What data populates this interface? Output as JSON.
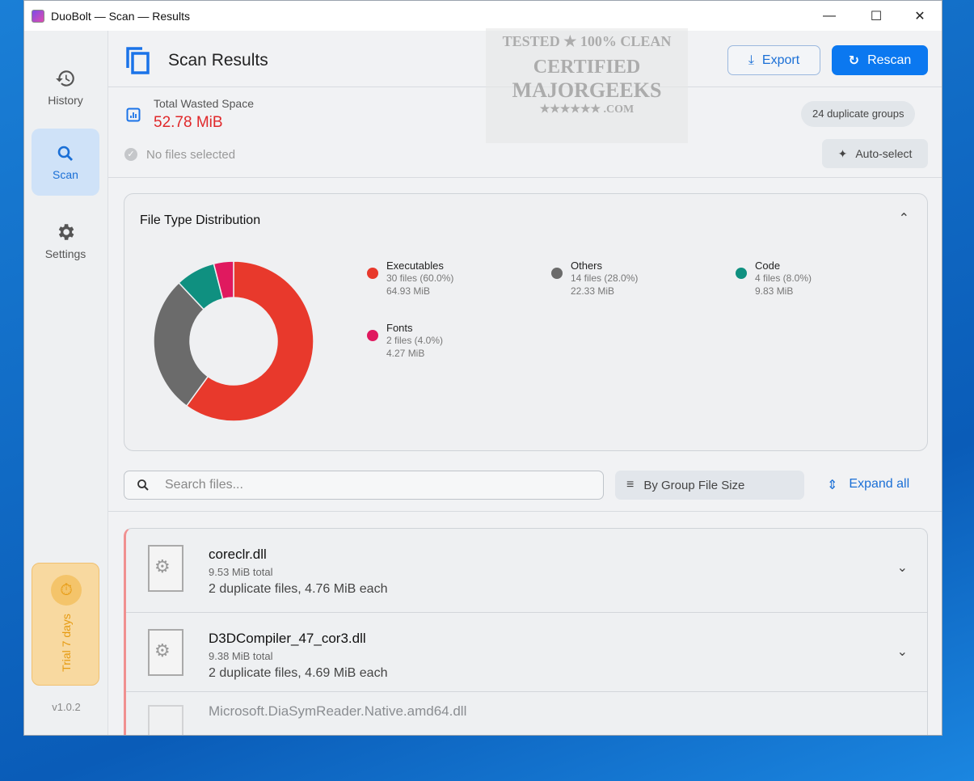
{
  "window": {
    "title": "DuoBolt — Scan — Results",
    "minimize": "—",
    "maximize": "☐",
    "close": "✕"
  },
  "sidebar": {
    "items": [
      {
        "label": "History",
        "icon": "history-icon"
      },
      {
        "label": "Scan",
        "icon": "search-icon"
      },
      {
        "label": "Settings",
        "icon": "gear-icon"
      }
    ],
    "trial": "Trial 7 days",
    "version": "v1.0.2"
  },
  "header": {
    "title": "Scan Results",
    "export": "Export",
    "rescan": "Rescan"
  },
  "stats": {
    "wasted_label": "Total Wasted Space",
    "wasted_value": "52.78 MiB",
    "selection": "No files selected",
    "groups_badge": "24 duplicate groups",
    "auto_select": "Auto-select"
  },
  "chart_data": {
    "type": "pie",
    "title": "File Type Distribution",
    "categories": [
      "Executables",
      "Others",
      "Code",
      "Fonts"
    ],
    "values": [
      60.0,
      28.0,
      8.0,
      4.0
    ],
    "files": [
      30,
      14,
      4,
      2
    ],
    "sizes": [
      "64.93 MiB",
      "22.33 MiB",
      "9.83 MiB",
      "4.27 MiB"
    ],
    "details": [
      "30 files (60.0%)",
      "14 files (28.0%)",
      "4 files (8.0%)",
      "2 files (4.0%)"
    ],
    "colors": [
      "#e8392c",
      "#6b6b6b",
      "#0f9080",
      "#e0195f"
    ]
  },
  "toolbar": {
    "search_placeholder": "Search files...",
    "sort": "By Group File Size",
    "expand": "Expand all"
  },
  "files": [
    {
      "name": "coreclr.dll",
      "total": "9.53 MiB total",
      "dups": "2 duplicate files, 4.76 MiB each"
    },
    {
      "name": "D3DCompiler_47_cor3.dll",
      "total": "9.38 MiB total",
      "dups": "2 duplicate files, 4.69 MiB each"
    },
    {
      "name": "Microsoft.DiaSymReader.Native.amd64.dll"
    }
  ],
  "watermark": {
    "line1": "TESTED ★ 100% CLEAN",
    "line2": "CERTIFIED",
    "line3": "MAJORGEEKS",
    "line4": "★★★★★★ .COM"
  }
}
